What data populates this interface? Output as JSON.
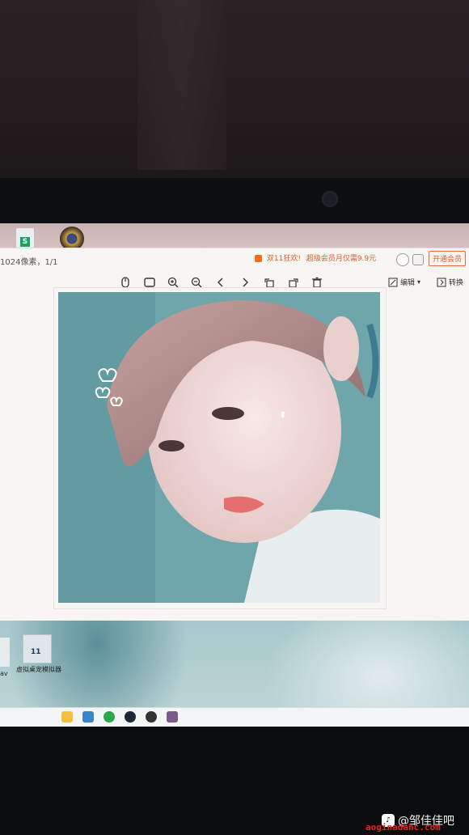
{
  "viewer": {
    "image_info": "1024像素，1/1",
    "promo_text": "双11狂欢!",
    "promo_vip": "超级会员月仅需9.9元",
    "open_vip_label": "开通会员",
    "edit_label": "编辑",
    "convert_label": "转换",
    "toolbar_icons": [
      "mouse-icon",
      "fit-window-icon",
      "zoom-in-icon",
      "zoom-out-icon",
      "prev-icon",
      "next-icon",
      "rotate-left-icon",
      "rotate-right-icon",
      "delete-icon"
    ]
  },
  "desktop": {
    "left_icon_label": "av",
    "emulator_label": "虚拟桌宠模拟器",
    "emulator_badge": "11"
  },
  "watermark": {
    "user": "@邹佳佳吧",
    "site": "aoginadahc.com"
  },
  "colors": {
    "promo": "#e05a2a",
    "photo_bg": "#6d9ea5"
  }
}
